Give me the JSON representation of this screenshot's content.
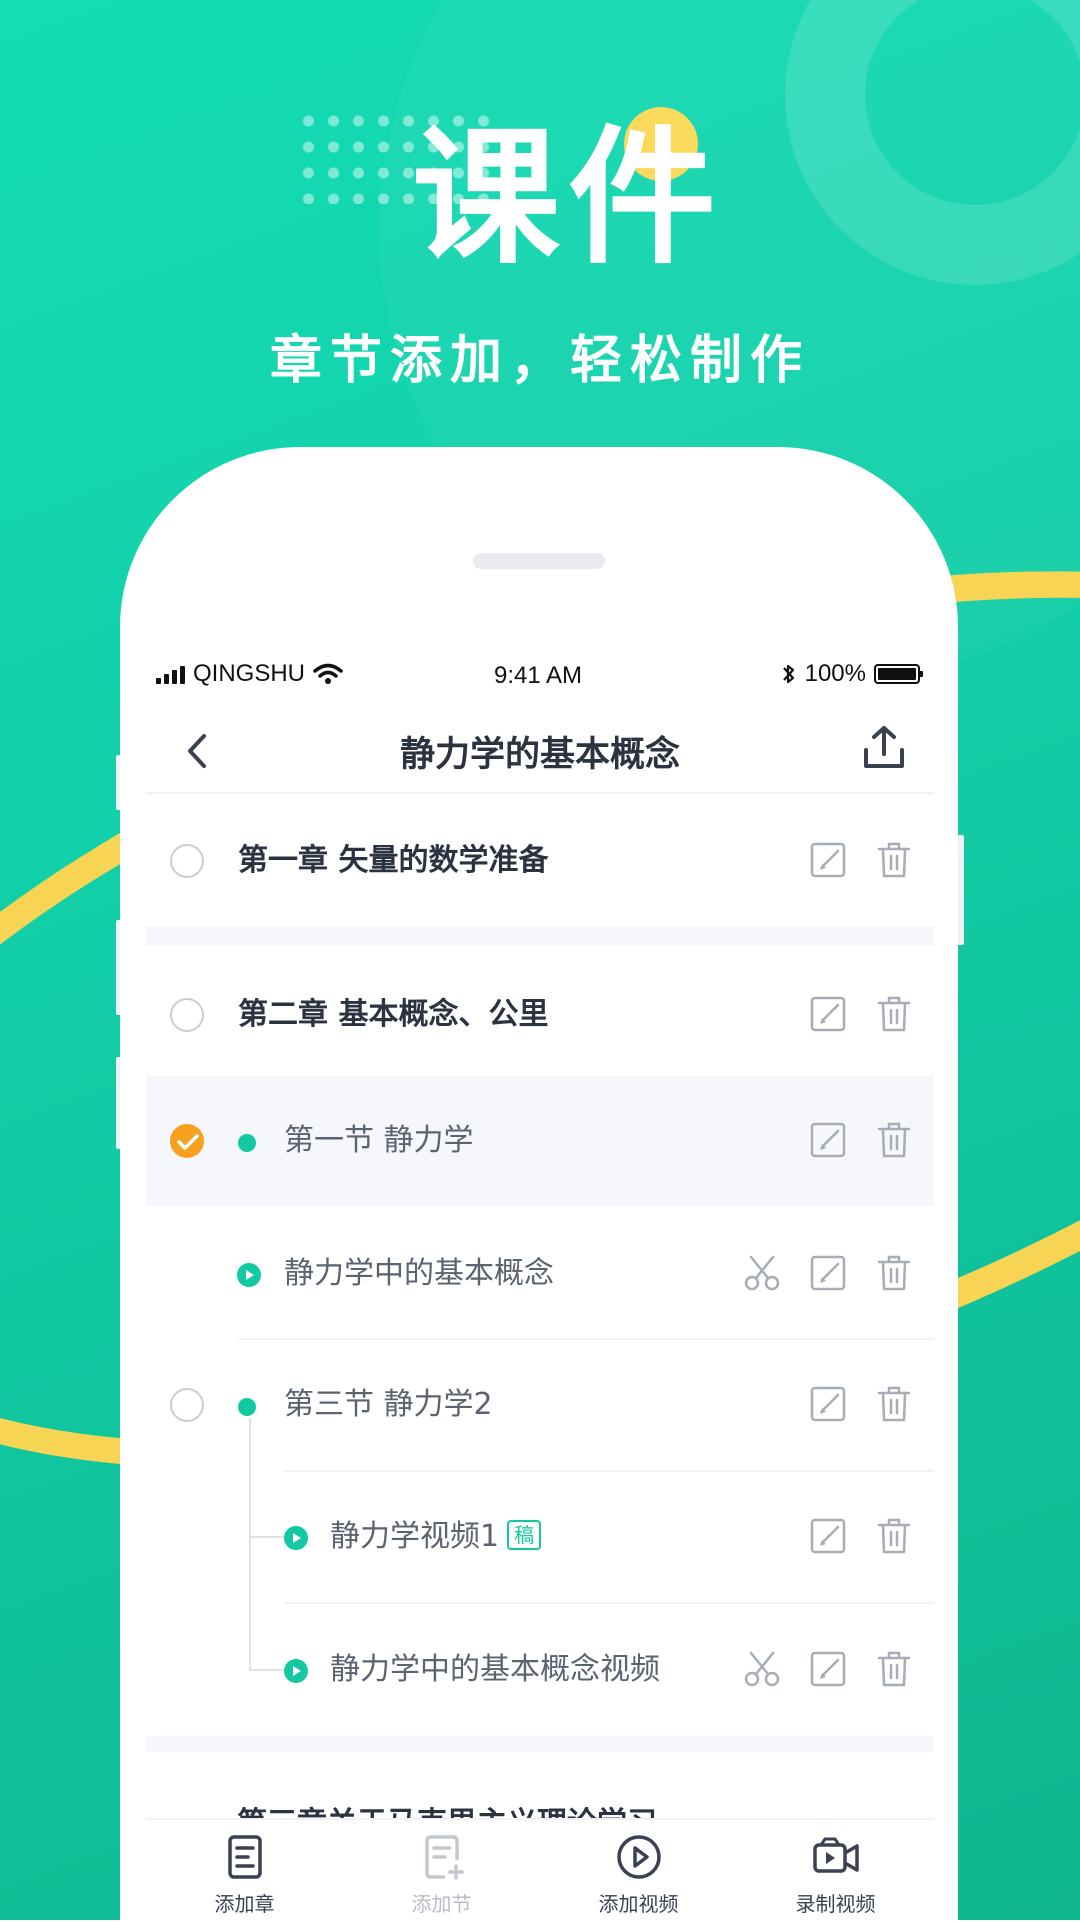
{
  "hero": {
    "title": "课件",
    "subtitle": "章节添加，轻松制作"
  },
  "status_bar": {
    "carrier": "QINGSHU",
    "time": "9:41 AM",
    "battery": "100%"
  },
  "nav": {
    "title": "静力学的基本概念",
    "back_icon": "chevron-left-icon",
    "share_icon": "share-icon"
  },
  "rows": [
    {
      "kind": "chapter",
      "label": "第一章  矢量的数学准备",
      "selected": false,
      "icons": [
        "edit-icon",
        "trash-icon"
      ]
    },
    {
      "kind": "chapter",
      "label": "第二章  基本概念、公里",
      "selected": false,
      "icons": [
        "edit-icon",
        "trash-icon"
      ]
    },
    {
      "kind": "section",
      "label": "第一节  静力学",
      "selected": true,
      "icons": [
        "edit-icon",
        "trash-icon"
      ]
    },
    {
      "kind": "video",
      "label": "静力学中的基本概念",
      "icons": [
        "scissors-icon",
        "edit-icon",
        "trash-icon"
      ]
    },
    {
      "kind": "section",
      "label": "第三节  静力学2",
      "selected": false,
      "icons": [
        "edit-icon",
        "trash-icon"
      ]
    },
    {
      "kind": "video",
      "label": "静力学视频1",
      "badge": "稿",
      "icons": [
        "edit-icon",
        "trash-icon"
      ]
    },
    {
      "kind": "video",
      "label": "静力学中的基本概念视频",
      "icons": [
        "scissors-icon",
        "edit-icon",
        "trash-icon"
      ]
    }
  ],
  "peek_row": "第三章关于马克思主义理论学习",
  "tabs": [
    {
      "label": "添加章",
      "icon": "document-icon",
      "enabled": true
    },
    {
      "label": "添加节",
      "icon": "add-document-icon",
      "enabled": false
    },
    {
      "label": "添加视频",
      "icon": "play-circle-icon",
      "enabled": true
    },
    {
      "label": "录制视频",
      "icon": "video-camera-icon",
      "enabled": true
    }
  ],
  "colors": {
    "accent": "#12c9a3",
    "selected_check": "#f7a020",
    "background": "#14dcb5",
    "stripe": "#f7d454"
  }
}
